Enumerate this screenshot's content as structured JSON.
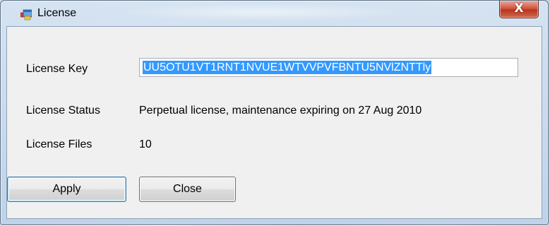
{
  "window": {
    "title": "License",
    "close_glyph": "X",
    "accent_color": "#3399ff",
    "close_button_color": "#c74a33"
  },
  "form": {
    "license_key_label": "License Key",
    "license_key_value": "UU5OTU1VT1RNT1NVUE1WTVVPVFBNTU5NVlZNTTly",
    "license_status_label": "License Status",
    "license_status_value": "Perpetual license, maintenance expiring on 27 Aug 2010",
    "license_files_label": "License Files",
    "license_files_value": "10"
  },
  "buttons": {
    "apply_label": "Apply",
    "close_label": "Close"
  },
  "icons": {
    "app": "application-window-icon",
    "close": "close-icon"
  }
}
